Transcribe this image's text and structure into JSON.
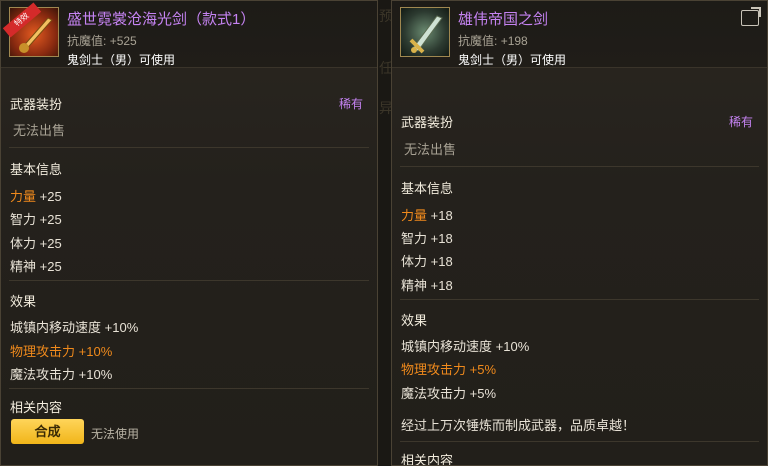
{
  "background": {
    "fragments": [
      "预",
      "任",
      "异"
    ]
  },
  "left": {
    "badge": "特效",
    "title": "盛世霓裳沧海光剑（款式1）",
    "stat_label": "抗魔值:",
    "stat_value": "+525",
    "requirement": "鬼剑士（男）可使用",
    "category": "武器装扮",
    "rarity": "稀有",
    "sell": "无法出售",
    "basic_info": "基本信息",
    "attrs": [
      {
        "name": "力量",
        "value": "+25"
      },
      {
        "name": "智力",
        "value": "+25"
      },
      {
        "name": "体力",
        "value": "+25"
      },
      {
        "name": "精神",
        "value": "+25"
      }
    ],
    "effects_title": "效果",
    "effects": [
      {
        "name": "城镇内移动速度",
        "value": "+10%"
      },
      {
        "name": "物理攻击力",
        "value": "+10%"
      },
      {
        "name": "魔法攻击力",
        "value": "+10%"
      }
    ],
    "related": "相关内容",
    "craft_button": "合成",
    "unusable": "无法使用"
  },
  "right": {
    "title": "雄伟帝国之剑",
    "stat_label": "抗魔值:",
    "stat_value": "+198",
    "requirement": "鬼剑士（男）可使用",
    "category": "武器装扮",
    "rarity": "稀有",
    "sell": "无法出售",
    "basic_info": "基本信息",
    "attrs": [
      {
        "name": "力量",
        "value": "+18"
      },
      {
        "name": "智力",
        "value": "+18"
      },
      {
        "name": "体力",
        "value": "+18"
      },
      {
        "name": "精神",
        "value": "+18"
      }
    ],
    "effects_title": "效果",
    "effects": [
      {
        "name": "城镇内移动速度",
        "value": "+10%"
      },
      {
        "name": "物理攻击力",
        "value": "+5%"
      },
      {
        "name": "魔法攻击力",
        "value": "+5%"
      }
    ],
    "description": "经过上万次锤炼而制成武器，品质卓越！",
    "related": "相关内容"
  },
  "colors": {
    "epic_purple": "#c583f2",
    "highlight_orange": "#f08a1c",
    "button_yellow": "#f1b519"
  }
}
